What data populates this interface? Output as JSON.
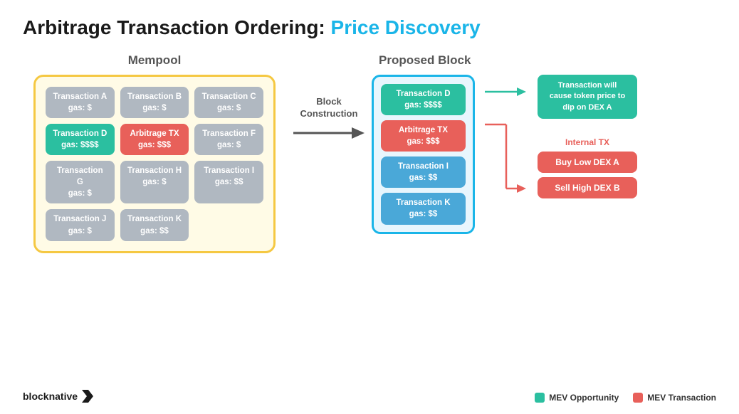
{
  "title": {
    "main": "Arbitrage Transaction Ordering: ",
    "accent": "Price Discovery"
  },
  "mempool": {
    "label": "Mempool",
    "transactions": [
      {
        "id": "tx-a",
        "name": "Transaction A",
        "gas": "gas: $",
        "style": "gray"
      },
      {
        "id": "tx-b",
        "name": "Transaction B",
        "gas": "gas: $",
        "style": "gray"
      },
      {
        "id": "tx-c",
        "name": "Transaction C",
        "gas": "gas: $",
        "style": "gray"
      },
      {
        "id": "tx-d",
        "name": "Transaction D",
        "gas": "gas: $$$$",
        "style": "teal"
      },
      {
        "id": "tx-arb",
        "name": "Arbitrage TX",
        "gas": "gas: $$$",
        "style": "red"
      },
      {
        "id": "tx-f",
        "name": "Transaction F",
        "gas": "gas: $",
        "style": "gray"
      },
      {
        "id": "tx-g",
        "name": "Transaction G",
        "gas": "gas: $",
        "style": "gray"
      },
      {
        "id": "tx-h",
        "name": "Transaction H",
        "gas": "gas: $",
        "style": "gray"
      },
      {
        "id": "tx-i",
        "name": "Transaction I",
        "gas": "gas: $$",
        "style": "gray"
      },
      {
        "id": "tx-j",
        "name": "Transaction J",
        "gas": "gas: $",
        "style": "gray"
      },
      {
        "id": "tx-k",
        "name": "Transaction K",
        "gas": "gas: $$",
        "style": "gray"
      }
    ]
  },
  "arrow": {
    "label": "Block\nConstruction"
  },
  "proposed_block": {
    "label": "Proposed Block",
    "transactions": [
      {
        "id": "block-tx-d",
        "name": "Transaction D",
        "gas": "gas: $$$$",
        "style": "teal"
      },
      {
        "id": "block-tx-arb",
        "name": "Arbitrage TX",
        "gas": "gas: $$$",
        "style": "red"
      },
      {
        "id": "block-tx-i",
        "name": "Transaction I",
        "gas": "gas: $$",
        "style": "blue"
      },
      {
        "id": "block-tx-k",
        "name": "Transaction K",
        "gas": "gas: $$",
        "style": "blue"
      }
    ]
  },
  "annotations": {
    "top_note": "Transaction will cause token price to dip on DEX A",
    "internal_tx_label": "Internal TX",
    "internal_txs": [
      {
        "id": "buy-low",
        "label": "Buy Low DEX A"
      },
      {
        "id": "sell-high",
        "label": "Sell High DEX B"
      }
    ]
  },
  "legend": {
    "items": [
      {
        "id": "mev-opportunity",
        "label": "MEV Opportunity",
        "color": "teal"
      },
      {
        "id": "mev-transaction",
        "label": "MEV Transaction",
        "color": "red"
      }
    ]
  },
  "logo": {
    "text": "blocknative"
  }
}
